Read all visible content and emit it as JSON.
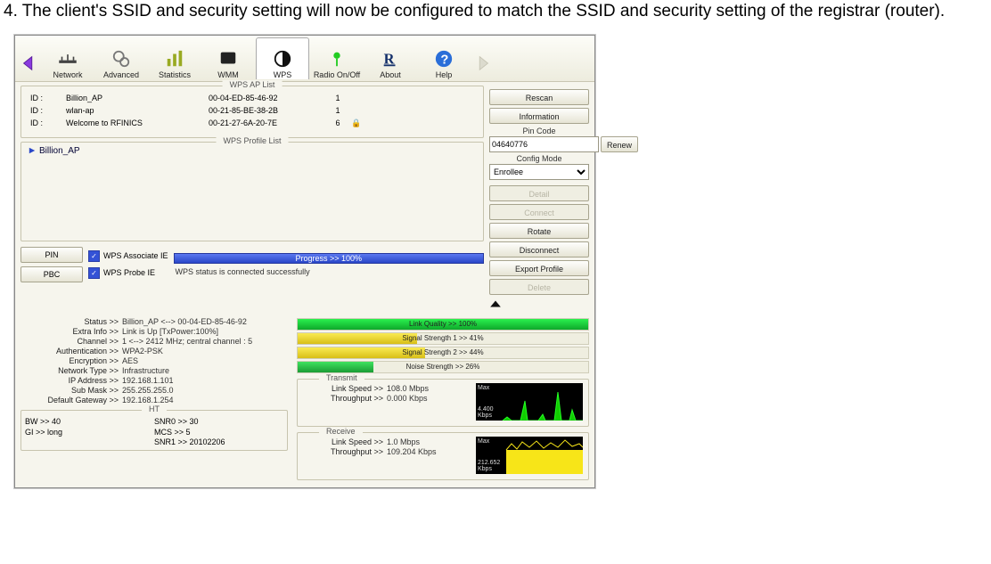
{
  "caption": "4. The client's SSID and security setting will now be configured to match the SSID and security setting of the registrar (router).",
  "toolbar": {
    "items": [
      {
        "id": "network",
        "label": "Network"
      },
      {
        "id": "advanced",
        "label": "Advanced"
      },
      {
        "id": "statistics",
        "label": "Statistics"
      },
      {
        "id": "wmm",
        "label": "WMM"
      },
      {
        "id": "wps",
        "label": "WPS"
      },
      {
        "id": "radio",
        "label": "Radio On/Off"
      },
      {
        "id": "about",
        "label": "About"
      },
      {
        "id": "help",
        "label": "Help"
      }
    ],
    "selected": "wps"
  },
  "ap_list": {
    "title": "WPS AP List",
    "rows": [
      {
        "id_label": "ID :",
        "ssid": "Billion_AP",
        "mac": "00-04-ED-85-46-92",
        "ch": "1",
        "locked": false
      },
      {
        "id_label": "ID :",
        "ssid": "wlan-ap",
        "mac": "00-21-85-BE-38-2B",
        "ch": "1",
        "locked": false
      },
      {
        "id_label": "ID :",
        "ssid": "Welcome to RFINICS",
        "mac": "00-21-27-6A-20-7E",
        "ch": "6",
        "locked": true
      }
    ]
  },
  "profile_list": {
    "title": "WPS Profile List",
    "items": [
      "Billion_AP"
    ]
  },
  "sidebar": {
    "rescan": "Rescan",
    "information": "Information",
    "pin_label": "Pin Code",
    "pin_value": "04640776",
    "renew": "Renew",
    "config_label": "Config Mode",
    "config_value": "Enrollee",
    "detail": "Detail",
    "connect": "Connect",
    "rotate": "Rotate",
    "disconnect": "Disconnect",
    "export": "Export Profile",
    "delete": "Delete"
  },
  "bottom": {
    "pin_btn": "PIN",
    "pbc_btn": "PBC",
    "assoc": "WPS Associate IE",
    "probe": "WPS Probe IE",
    "progress": "Progress >> 100%",
    "status": "WPS status is connected successfully"
  },
  "details": {
    "status_k": "Status >>",
    "status_v": "Billion_AP <--> 00-04-ED-85-46-92",
    "extra_k": "Extra Info >>",
    "extra_v": "Link is Up [TxPower:100%]",
    "channel_k": "Channel >>",
    "channel_v": "1 <--> 2412 MHz; central channel : 5",
    "auth_k": "Authentication >>",
    "auth_v": "WPA2-PSK",
    "enc_k": "Encryption >>",
    "enc_v": "AES",
    "ntype_k": "Network Type >>",
    "ntype_v": "Infrastructure",
    "ip_k": "IP Address >>",
    "ip_v": "192.168.1.101",
    "mask_k": "Sub Mask >>",
    "mask_v": "255.255.255.0",
    "gw_k": "Default Gateway >>",
    "gw_v": "192.168.1.254"
  },
  "ht": {
    "title": "HT",
    "bw": "BW >> 40",
    "snr0": "SNR0 >> 30",
    "gi": "GI >> long",
    "mcs": "MCS >> 5",
    "snr1": "SNR1 >> 20102206"
  },
  "bars": {
    "lq": {
      "label": "Link Quality >> 100%",
      "pct": 100,
      "color1": "#19e03a",
      "color2": "#0fa726"
    },
    "s1": {
      "label": "Signal Strength 1 >> 41%",
      "pct": 41,
      "color1": "#f4e23a",
      "color2": "#d8bf18"
    },
    "s2": {
      "label": "Signal Strength 2 >> 44%",
      "pct": 44,
      "color1": "#f4e23a",
      "color2": "#d8bf18"
    },
    "ns": {
      "label": "Noise Strength >> 26%",
      "pct": 26,
      "color1": "#2fc94c",
      "color2": "#1a9c34"
    }
  },
  "transmit": {
    "title": "Transmit",
    "ls_k": "Link Speed >>",
    "ls_v": "108.0 Mbps",
    "tp_k": "Throughput >>",
    "tp_v": "0.000 Kbps",
    "g_label": "Max",
    "g_value": "4.400\nKbps"
  },
  "receive": {
    "title": "Receive",
    "ls_k": "Link Speed >>",
    "ls_v": "1.0 Mbps",
    "tp_k": "Throughput >>",
    "tp_v": "109.204 Kbps",
    "g_label": "Max",
    "g_value": "212.652\nKbps"
  }
}
